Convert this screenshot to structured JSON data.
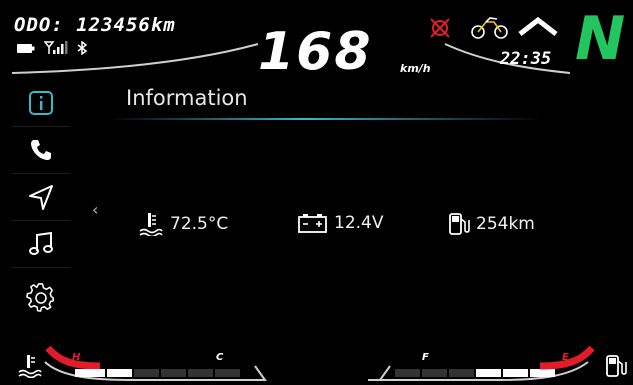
{
  "odometer": {
    "label": "ODO:",
    "value": "123456",
    "unit": "km"
  },
  "speed": {
    "value": "168",
    "unit": "km/h"
  },
  "clock": "22:35",
  "gear": "N",
  "status_icons": [
    "battery-icon",
    "signal-icon",
    "bluetooth-icon"
  ],
  "warning_icons": [
    "abs-off-icon",
    "motorbike-icon",
    "high-beam-icon"
  ],
  "sidebar": {
    "items": [
      {
        "name": "info",
        "icon": "info-icon",
        "active": true
      },
      {
        "name": "phone",
        "icon": "phone-icon",
        "active": false
      },
      {
        "name": "navigation",
        "icon": "navigation-icon",
        "active": false
      },
      {
        "name": "music",
        "icon": "music-icon",
        "active": false
      },
      {
        "name": "settings",
        "icon": "gear-icon",
        "active": false
      }
    ]
  },
  "page": {
    "title": "Information"
  },
  "info": [
    {
      "name": "coolant-temp",
      "icon": "coolant-temp-icon",
      "value": "72.5°C"
    },
    {
      "name": "battery-voltage",
      "icon": "battery-icon",
      "value": "12.4V"
    },
    {
      "name": "fuel-range",
      "icon": "fuel-icon",
      "value": "254km"
    }
  ],
  "gauges": {
    "temp": {
      "low": "C",
      "high": "H",
      "icon": "coolant-temp-icon",
      "level_fraction": 0.33
    },
    "fuel": {
      "low": "E",
      "high": "F",
      "icon": "fuel-icon",
      "level_fraction": 0.66
    }
  },
  "colors": {
    "accent": "#3fb6c8",
    "gear": "#22c55e",
    "warning": "#e11d2a",
    "gauge_high": "#e11d2a"
  }
}
